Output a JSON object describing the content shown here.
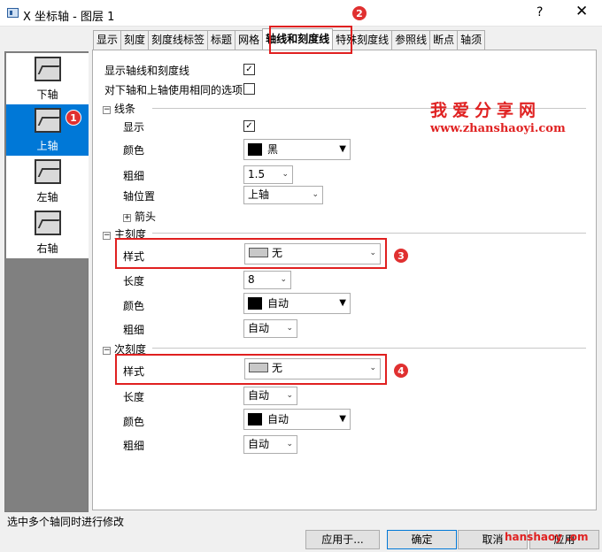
{
  "window": {
    "title": "X 坐标轴 - 图层 1",
    "help": "?",
    "close": "✕"
  },
  "tabs": [
    "显示",
    "刻度",
    "刻度线标签",
    "标题",
    "网格",
    "轴线和刻度线",
    "特殊刻度线",
    "参照线",
    "断点",
    "轴须"
  ],
  "active_tab": "轴线和刻度线",
  "axes": [
    "下轴",
    "上轴",
    "左轴",
    "右轴"
  ],
  "selected_axis": "上轴",
  "options": {
    "show_axis_and_ticks": {
      "label": "显示轴线和刻度线",
      "checked": true
    },
    "same_options": {
      "label": "对下轴和上轴使用相同的选项",
      "checked": false
    }
  },
  "line": {
    "title": "线条",
    "show_label": "显示",
    "show_checked": true,
    "color_label": "颜色",
    "color_value": "黑",
    "thickness_label": "粗细",
    "thickness_value": "1.5",
    "position_label": "轴位置",
    "position_value": "上轴",
    "arrow_label": "箭头"
  },
  "major": {
    "title": "主刻度",
    "style_label": "样式",
    "style_value": "无",
    "length_label": "长度",
    "length_value": "8",
    "color_label": "颜色",
    "color_value": "自动",
    "thickness_label": "粗细",
    "thickness_value": "自动"
  },
  "minor": {
    "title": "次刻度",
    "style_label": "样式",
    "style_value": "无",
    "length_label": "长度",
    "length_value": "自动",
    "color_label": "颜色",
    "color_value": "自动",
    "thickness_label": "粗细",
    "thickness_value": "自动"
  },
  "markers": [
    "1",
    "2",
    "3",
    "4"
  ],
  "watermark": {
    "title": "我爱分享网",
    "url": "www.zhanshaoyi.com",
    "corner": "hanshaoy .om"
  },
  "status": "选中多个轴同时进行修改",
  "buttons": {
    "apply_to": "应用于...",
    "ok": "确定",
    "cancel": "取消",
    "apply": "应用"
  },
  "colors": {
    "marker": "#e02020",
    "selection": "#0078d7"
  }
}
